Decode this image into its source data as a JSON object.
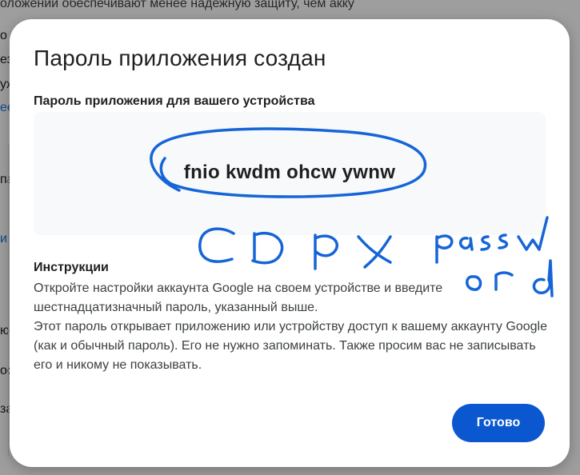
{
  "background": {
    "top_text": "оложении обеспечивают менее надежную защиту, чем акку",
    "side_fragments": [
      "о",
      "ез",
      "уж",
      "ее",
      "па",
      "и",
      "ю",
      "ос",
      "за"
    ]
  },
  "dialog": {
    "title": "Пароль приложения создан",
    "password_label": "Пароль приложения для вашего устройства",
    "password": "fnio kwdm ohcw ywnw",
    "instructions_title": "Инструкции",
    "instructions": [
      "Откройте настройки аккаунта Google на своем устройстве и введите шестнадцатизначный пароль, указанный выше.",
      "Этот пароль открывает приложению или устройству доступ к вашему аккаунту Google (как и обычный пароль). Его не нужно запоминать. Также просим вас не записывать его и никому не показывать."
    ],
    "done_label": "Готово"
  },
  "handwriting": {
    "text": "copy passw ord",
    "color": "#1565d8"
  },
  "colors": {
    "primary_button": "#0b57d0",
    "password_box": "#f8f9fa",
    "overlay": "#5f6368"
  }
}
